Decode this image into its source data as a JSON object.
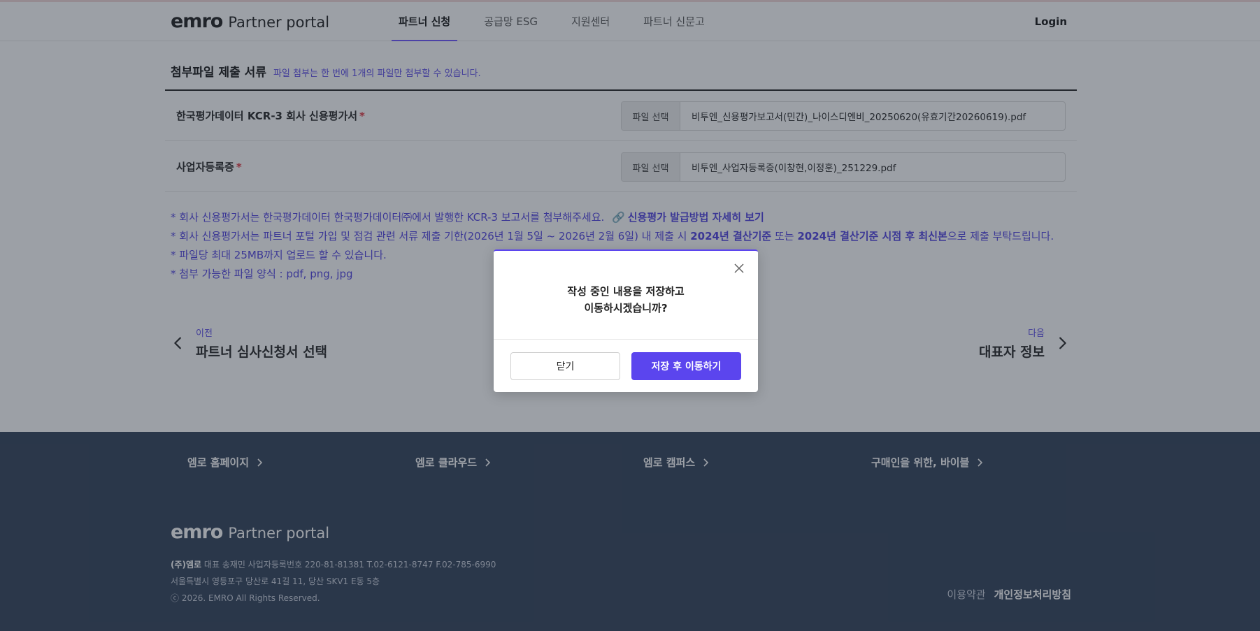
{
  "header": {
    "logo_mark": "emro",
    "logo_text": "Partner portal",
    "tabs": [
      {
        "label": "파트너 신청"
      },
      {
        "label": "공급망 ESG"
      },
      {
        "label": "지원센터"
      },
      {
        "label": "파트너 신문고"
      }
    ],
    "active_tab": "파트너 신청",
    "login": "Login"
  },
  "section": {
    "title": "첨부파일 제출 서류",
    "note": "파일 첨부는 한 번에 1개의 파일만 첨부할 수 있습니다."
  },
  "files": [
    {
      "label": "한국평가데이터 KCR-3 회사 신용평가서",
      "required": "*",
      "button": "파일 선택",
      "filename": "비투엔_신용평가보고서(민간)_나이스디엔비_20250620(유효기간20260619).pdf"
    },
    {
      "label": "사업자등록증",
      "required": "*",
      "button": "파일 선택",
      "filename": "비투엔_사업자등록증(이창현,이정훈)_251229.pdf"
    }
  ],
  "notes": {
    "line1": "* 회사 신용평가서는 한국평가데이터 한국평가데이터㈜에서 발행한 KCR-3 보고서를 첨부해주세요.",
    "line1_link": "신용평가 발급방법 자세히 보기",
    "line2_a": "* 회사 신용평가서는 파트너 포털 가입 및 점검 관련 서류 제출 기한(2026년 1월 5일 ~ 2026년 2월 6일) 내 제출 시 ",
    "line2_b": "2024년 결산기준",
    "line2_c": " 또는 ",
    "line2_d": "2024년 결산기준 시점 후 최신본",
    "line2_e": "으로 제출 부탁드립니다.",
    "line3": "* 파일당 최대 25MB까지 업로드 할 수 있습니다.",
    "line4": "* 첨부 가능한 파일 양식 : pdf, png, jpg"
  },
  "pager": {
    "prev_small": "이전",
    "prev_big": "파트너 심사신청서 선택",
    "next_small": "다음",
    "next_big": "대표자 정보"
  },
  "footer": {
    "links": [
      "엠로 홈페이지",
      "엠로 클라우드",
      "엠로 캠퍼스",
      "구매인을 위한, 바이블"
    ],
    "logo_mark": "emro",
    "logo_text": "Partner portal",
    "company": "(주)엠로",
    "info1": " 대표 송재민 사업자등록번호 220-81-81381 T.02-6121-8747 F.02-785-6990",
    "info2": "서울특별시 영등포구 당산로 41길 11, 당산 SKV1 E동 5층",
    "copyright": "ⓒ 2026. EMRO All Rights Reserved.",
    "terms": "이용약관",
    "privacy": "개인정보처리방침"
  },
  "modal": {
    "message_line1": "작성 중인 내용을 저장하고",
    "message_line2": "이동하시겠습니까?",
    "close_label": "닫기",
    "save_label": "저장 후 이동하기"
  },
  "colors": {
    "accent": "#5b45ee",
    "required": "#e0313c",
    "footer_bg": "#2e3d55",
    "overlay": "rgba(40,48,60,0.46)"
  }
}
